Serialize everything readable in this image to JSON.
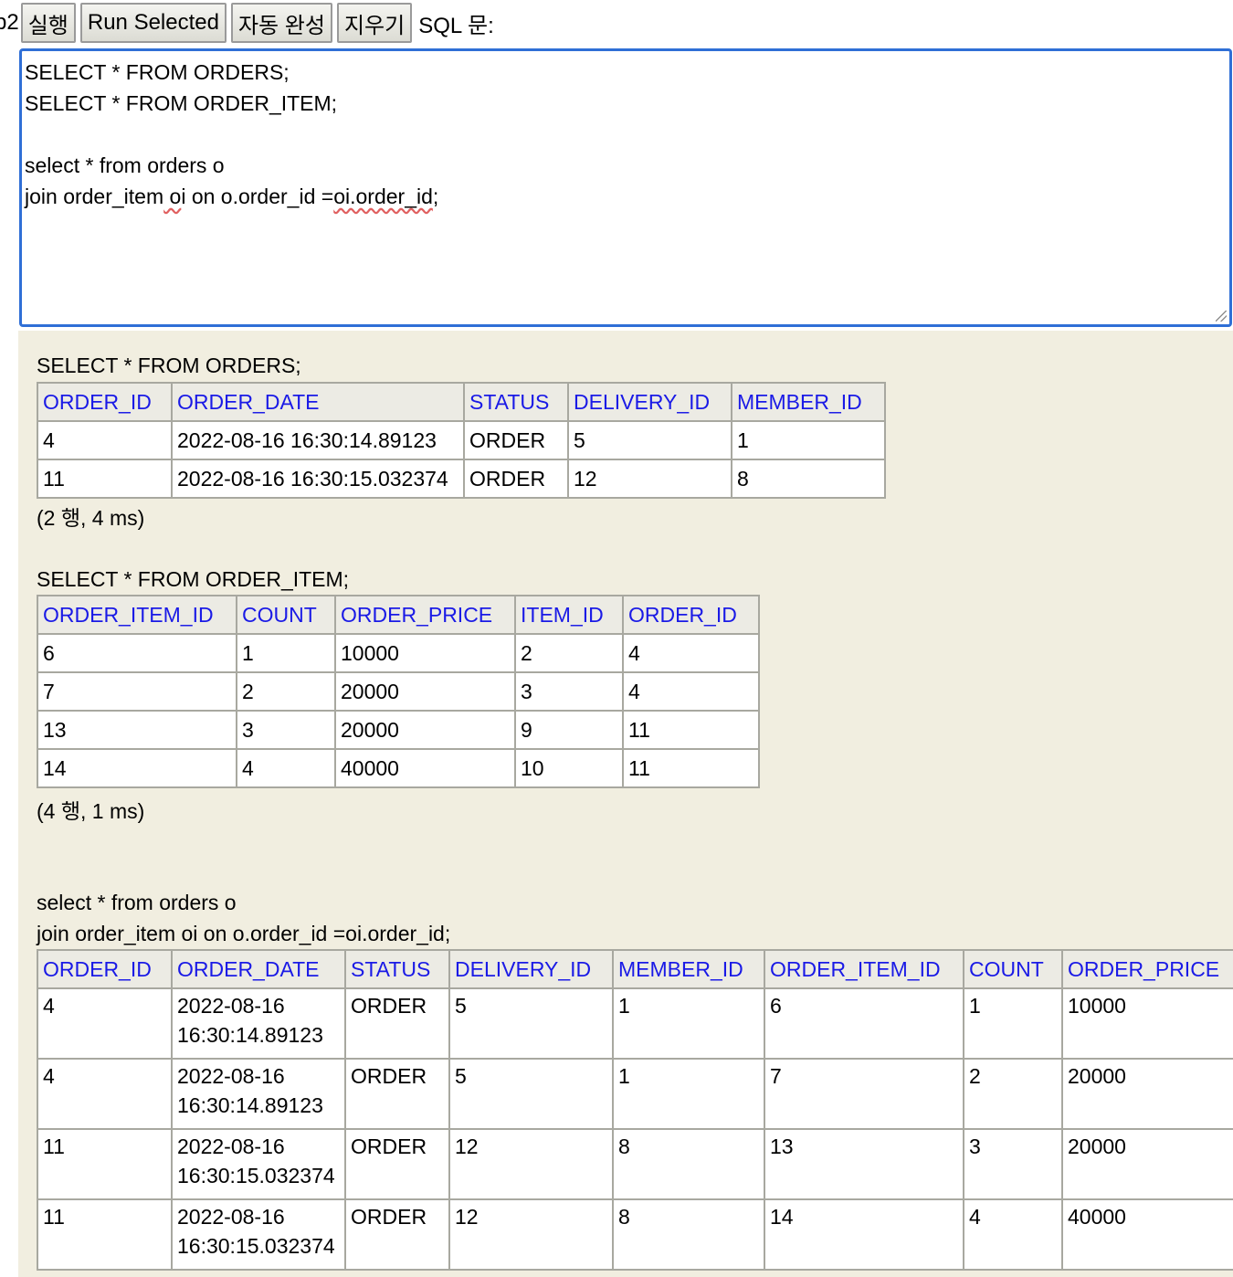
{
  "toolbar": {
    "cut_text": "p2",
    "buttons": [
      {
        "label": "실행"
      },
      {
        "label": "Run Selected"
      },
      {
        "label": "자동 완성"
      },
      {
        "label": "지우기"
      }
    ],
    "sql_label": "SQL 문:"
  },
  "editor": {
    "lines": [
      "SELECT * FROM ORDERS;",
      "SELECT * FROM ORDER_ITEM;",
      "",
      "select * from orders o",
      "join order_item oi on o.order_id =oi.order_id;"
    ]
  },
  "results": [
    {
      "query": "SELECT * FROM ORDERS;",
      "columns": [
        "ORDER_ID",
        "ORDER_DATE",
        "STATUS",
        "DELIVERY_ID",
        "MEMBER_ID"
      ],
      "rows": [
        [
          "4",
          "2022-08-16 16:30:14.89123",
          "ORDER",
          "5",
          "1"
        ],
        [
          "11",
          "2022-08-16 16:30:15.032374",
          "ORDER",
          "12",
          "8"
        ]
      ],
      "status": "(2 행, 4 ms)"
    },
    {
      "query": "SELECT * FROM ORDER_ITEM;",
      "columns": [
        "ORDER_ITEM_ID",
        "COUNT",
        "ORDER_PRICE",
        "ITEM_ID",
        "ORDER_ID"
      ],
      "rows": [
        [
          "6",
          "1",
          "10000",
          "2",
          "4"
        ],
        [
          "7",
          "2",
          "20000",
          "3",
          "4"
        ],
        [
          "13",
          "3",
          "20000",
          "9",
          "11"
        ],
        [
          "14",
          "4",
          "40000",
          "10",
          "11"
        ]
      ],
      "status": "(4 행, 1 ms)"
    },
    {
      "query_lines": [
        "select * from orders o",
        "join order_item oi on o.order_id =oi.order_id;"
      ],
      "columns": [
        "ORDER_ID",
        "ORDER_DATE",
        "STATUS",
        "DELIVERY_ID",
        "MEMBER_ID",
        "ORDER_ITEM_ID",
        "COUNT",
        "ORDER_PRICE"
      ],
      "rows": [
        [
          "4",
          "2022-08-16 16:30:14.89123",
          "ORDER",
          "5",
          "1",
          "6",
          "1",
          "10000"
        ],
        [
          "4",
          "2022-08-16 16:30:14.89123",
          "ORDER",
          "5",
          "1",
          "7",
          "2",
          "20000"
        ],
        [
          "11",
          "2022-08-16 16:30:15.032374",
          "ORDER",
          "12",
          "8",
          "13",
          "3",
          "20000"
        ],
        [
          "11",
          "2022-08-16 16:30:15.032374",
          "ORDER",
          "12",
          "8",
          "14",
          "4",
          "40000"
        ]
      ]
    }
  ]
}
